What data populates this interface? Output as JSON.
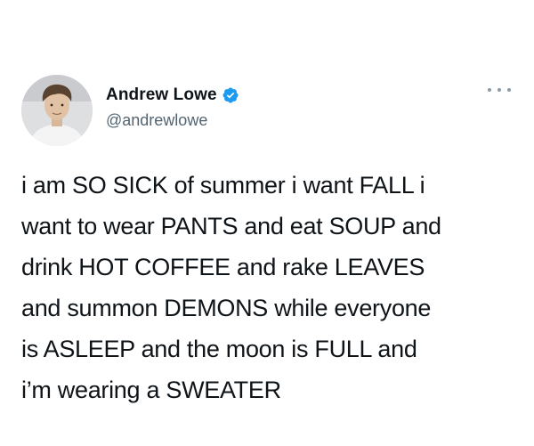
{
  "tweet": {
    "author": {
      "display_name": "Andrew Lowe",
      "handle": "@andrewlowe",
      "verified": true,
      "avatar_icon": "user-avatar"
    },
    "more_icon": "more-options-icon",
    "text_lines": [
      "i am SO SICK of summer i want FALL i",
      "want to wear PANTS and eat SOUP and",
      "drink HOT COFFEE and rake LEAVES",
      "and summon DEMONS while everyone",
      "is ASLEEP and the moon is FULL and",
      "i’m wearing a SWEATER"
    ]
  },
  "colors": {
    "text": "#0f1419",
    "secondary": "#536471",
    "verified_blue": "#1d9bf0",
    "background": "#ffffff"
  }
}
